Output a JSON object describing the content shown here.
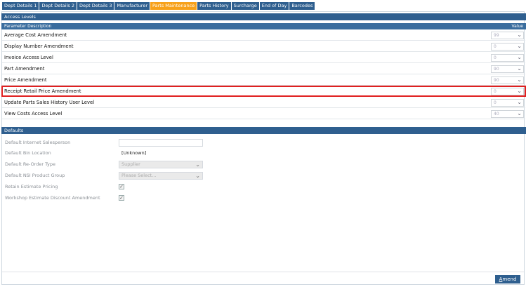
{
  "tabs": [
    {
      "label": "Dept Details 1",
      "active": false
    },
    {
      "label": "Dept Details 2",
      "active": false
    },
    {
      "label": "Dept Details 3",
      "active": false
    },
    {
      "label": "Manufacturer",
      "active": false
    },
    {
      "label": "Parts Maintenance",
      "active": true
    },
    {
      "label": "Parts History",
      "active": false
    },
    {
      "label": "Surcharge",
      "active": false
    },
    {
      "label": "End of Day",
      "active": false
    },
    {
      "label": "Barcodes",
      "active": false
    }
  ],
  "access_levels": {
    "title": "Access Levels",
    "col_description": "Parameter Description",
    "col_value": "Value",
    "rows": [
      {
        "label": "Average Cost Amendment",
        "value": "99"
      },
      {
        "label": "Display Number Amendment",
        "value": "0"
      },
      {
        "label": "Invoice Access Level",
        "value": "0"
      },
      {
        "label": "Part Amendment",
        "value": "90"
      },
      {
        "label": "Price Amendment",
        "value": "90"
      },
      {
        "label": "Receipt Retail Price Amendment",
        "value": "0"
      },
      {
        "label": "Update Parts Sales History User Level",
        "value": "0"
      },
      {
        "label": "View Costs Access Level",
        "value": "40"
      }
    ]
  },
  "defaults": {
    "title": "Defaults",
    "internet_salesperson": {
      "label": "Default Internet Salesperson",
      "value": ""
    },
    "bin_location": {
      "label": "Default Bin Location",
      "value": "[Unknown]"
    },
    "reorder_type": {
      "label": "Default Re-Order Type",
      "value": "Supplier"
    },
    "nsi_group": {
      "label": "Default NSI Product Group",
      "value": "Please Select..."
    },
    "retain_estimate": {
      "label": "Retain Estimate Pricing",
      "checked": true
    },
    "workshop_discount": {
      "label": "Workshop Estimate Discount Amendment",
      "checked": true
    }
  },
  "amend_label_first": "A",
  "amend_label_rest": "mend",
  "colors": {
    "header": "#2f5f8f",
    "active_tab": "#f7a11a",
    "highlight": "#e02020"
  }
}
